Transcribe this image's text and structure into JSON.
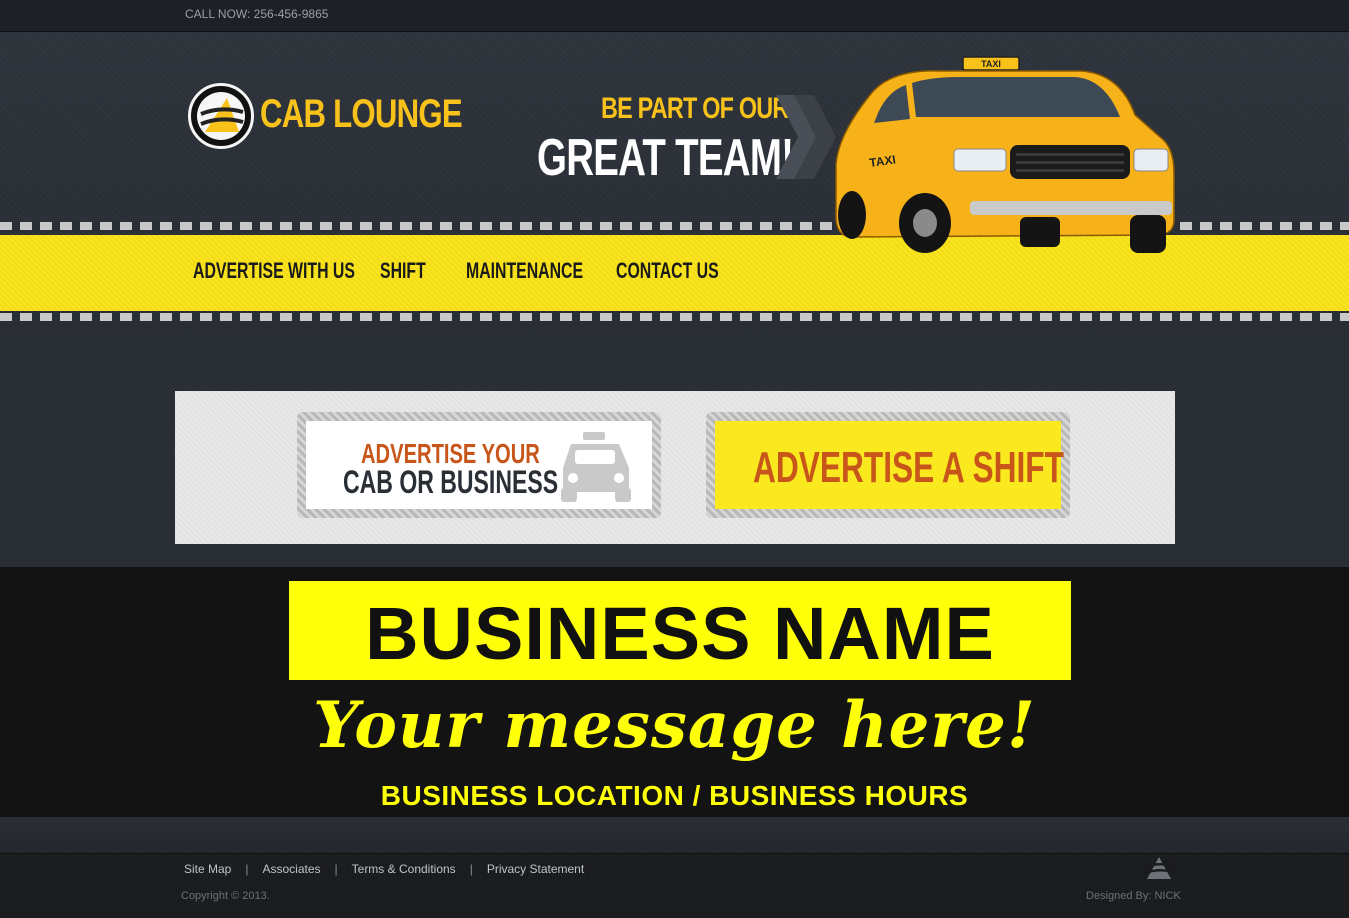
{
  "topbar": {
    "phone": "CALL NOW: 256-456-9865"
  },
  "brand": {
    "name": "CAB LOUNGE",
    "logo_icon": "cab-lounge-logo-icon"
  },
  "hero": {
    "line1": "BE PART OF OUR",
    "line2": "GREAT TEAM!",
    "image": "taxi-car"
  },
  "taxi_sign": "TAXI",
  "nav": {
    "items": [
      {
        "label": "ADVERTISE WITH US"
      },
      {
        "label": "SHIFT"
      },
      {
        "label": "MAINTENANCE"
      },
      {
        "label": "CONTACT US"
      }
    ]
  },
  "promos": {
    "advertise_cab_line1": "ADVERTISE YOUR",
    "advertise_cab_line2": "CAB OR BUSINESS",
    "advertise_cab_icon": "car-icon",
    "advertise_shift": "ADVERTISE A SHIFT"
  },
  "ad_banner": {
    "business_name": "BUSINESS NAME",
    "message": "Your message here!",
    "location_hours": "BUSINESS LOCATION / BUSINESS HOURS"
  },
  "footer": {
    "links": [
      {
        "label": "Site Map"
      },
      {
        "label": "Associates"
      },
      {
        "label": "Terms & Conditions"
      },
      {
        "label": "Privacy Statement"
      }
    ],
    "separator": "|",
    "copyright": "Copyright © 2013.",
    "designer": "Designed By: NICK"
  },
  "colors": {
    "accent_yellow": "#f8c21a",
    "nav_yellow": "#f9e31c",
    "banner_yellow": "#ffff0a",
    "promo_orange": "#c8561a",
    "dark_bg": "#2a2e35"
  }
}
